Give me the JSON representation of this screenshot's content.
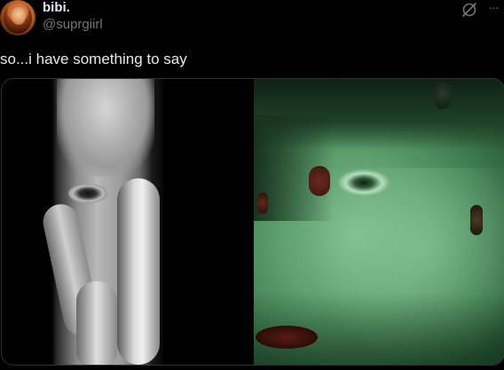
{
  "user": {
    "display_name": "bibi.",
    "handle": "@suprgiirl"
  },
  "tweet": {
    "text": "so...i have something to say"
  },
  "actions": {
    "more_label": "···"
  },
  "media": {
    "photo_count": 2
  },
  "colors": {
    "background": "#000000",
    "text_primary": "#e7e9ea",
    "text_secondary": "#71767b",
    "border": "#2f3336"
  }
}
